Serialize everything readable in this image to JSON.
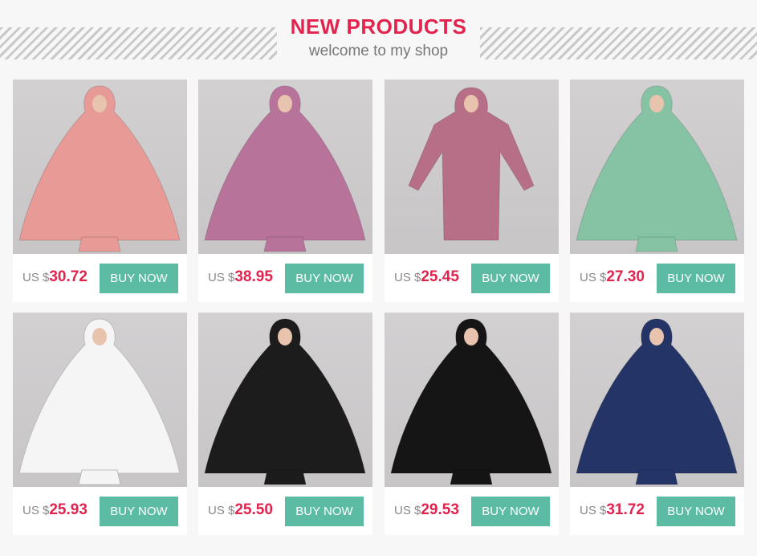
{
  "header": {
    "title": "NEW PRODUCTS",
    "subtitle": "welcome to my shop"
  },
  "currency_label": "US $",
  "buy_label": "BUY NOW",
  "products": [
    {
      "price": "30.72",
      "color": "#e79a96",
      "icon": "hijab-dress-image"
    },
    {
      "price": "38.95",
      "color": "#b8739a",
      "icon": "hijab-dress-image"
    },
    {
      "price": "25.45",
      "color": "#b76e87",
      "icon": "abaya-dress-image"
    },
    {
      "price": "27.30",
      "color": "#86c3a5",
      "icon": "hijab-dress-image"
    },
    {
      "price": "25.93",
      "color": "#f5f5f5",
      "icon": "hijab-dress-image"
    },
    {
      "price": "25.50",
      "color": "#1c1c1c",
      "icon": "hijab-dress-image"
    },
    {
      "price": "29.53",
      "color": "#151515",
      "icon": "hijab-dress-image"
    },
    {
      "price": "31.72",
      "color": "#243466",
      "icon": "hijab-dress-image"
    }
  ]
}
